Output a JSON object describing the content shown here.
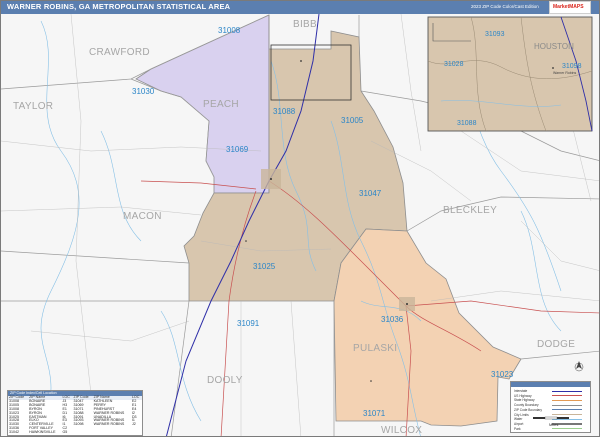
{
  "header": {
    "title": "WARNER ROBINS, GA METROPOLITAN STATISTICAL AREA",
    "edition": "2023 ZIP Code Color/Cast Edition",
    "brand": "MarketMAPS"
  },
  "colors": {
    "header": "#5b7fb0",
    "houston_fill": "#d8c6ae",
    "peach_fill": "#d9d1ef",
    "pulaski_fill": "#f3d2b3",
    "zip_label": "#2c86c8",
    "county_label": "#a6a6a6",
    "interstate": "#2f2fa8",
    "us_highway": "#c85050",
    "county_line": "#8e8e8e"
  },
  "counties": {
    "crawford": "CRAWFORD",
    "bibb": "BIBB",
    "houston": "HOUSTON",
    "taylor": "TAYLOR",
    "peach": "PEACH",
    "macon": "MACON",
    "bleckley": "BLECKLEY",
    "pulaski": "PULASKI",
    "dodge": "DODGE",
    "dooly": "DOOLY",
    "wilcox": "WILCOX"
  },
  "zips": {
    "z31008": "31008",
    "z31030": "31030",
    "z31088": "31088",
    "z31005": "31005",
    "z31069": "31069",
    "z31047": "31047",
    "z31025": "31025",
    "z31091": "31091",
    "z31036": "31036",
    "z31023": "31023",
    "z31071": "31071"
  },
  "inset": {
    "zip_31093": "31093",
    "zip_31028": "31028",
    "zip_31098": "31098",
    "zip_31088": "31088",
    "county_houston": "HOUSTON",
    "place": "Warner Robins"
  },
  "zip_table": {
    "title": "ZIP Code Index/Cell Location",
    "headers": [
      "ZIP Code",
      "ZIP Name",
      "LOC",
      "ZIP Code",
      "ZIP Name",
      "LOC"
    ],
    "rows": [
      [
        "31008",
        "BONAIRE",
        "J3",
        "31047",
        "KATHLEEN",
        "E2"
      ],
      [
        "31005",
        "BONAIRE",
        "H3",
        "31069",
        "PERRY",
        "E1"
      ],
      [
        "31008",
        "BYRON",
        "E1",
        "31071",
        "PINEHURST",
        "E4"
      ],
      [
        "31023",
        "BYRON",
        "D1",
        "31088",
        "WARNER ROBINS",
        "I2"
      ],
      [
        "31025",
        "EASTMAN",
        "I6",
        "31091",
        "UNADILLA",
        "D3"
      ],
      [
        "31028",
        "ELKO",
        "E3",
        "31093",
        "WARNER ROBINS",
        "I1"
      ],
      [
        "31030",
        "CENTERVILLE",
        "I1",
        "31098",
        "WARNER ROBINS",
        "J2"
      ],
      [
        "31036",
        "FORT VALLEY",
        "C2",
        "",
        "",
        ""
      ],
      [
        "31042",
        "HAWKINSVILLE",
        "G5",
        "",
        "",
        ""
      ]
    ]
  },
  "legend": {
    "rows": [
      "Interstate",
      "US Highway",
      "State Highway",
      "County Boundary",
      "ZIP Code Boundary",
      "City Limits",
      "Water",
      "Airport",
      "Park"
    ]
  },
  "scale": {
    "label": "Miles"
  }
}
